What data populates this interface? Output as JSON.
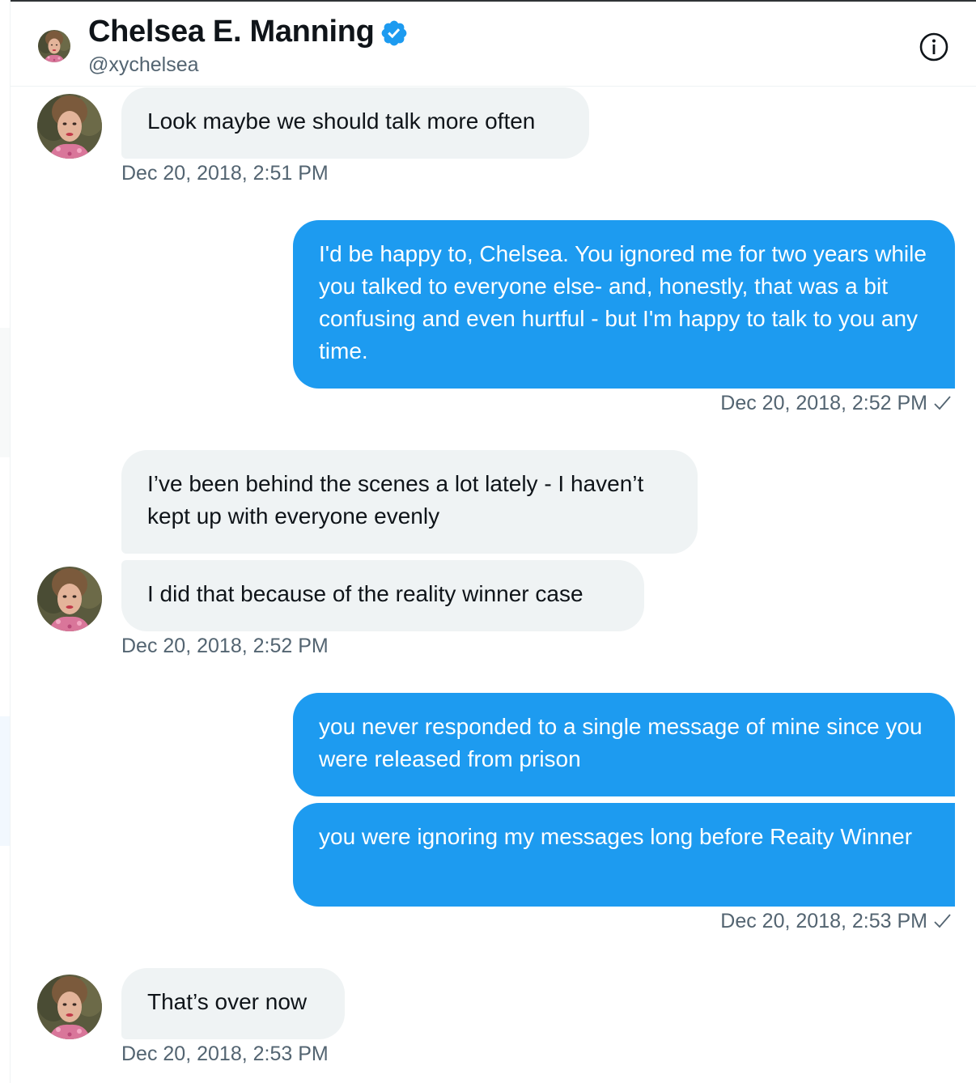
{
  "header": {
    "name": "Chelsea E. Manning",
    "handle": "@xychelsea",
    "verified_icon": "verified-badge-icon",
    "info_icon": "info-icon"
  },
  "colors": {
    "accent": "#1d9bf0",
    "incoming_bubble": "#eff3f4",
    "text_primary": "#0f1419",
    "text_secondary": "#536471"
  },
  "messages": [
    {
      "direction": "incoming",
      "text": "Look maybe we should talk more often",
      "time": "Dec 20, 2018, 2:51 PM"
    },
    {
      "direction": "outgoing",
      "text": "I'd be happy to, Chelsea. You ignored me for two years while you talked to everyone else-  and, honestly, that was a bit confusing and even hurtful - but I'm happy to talk to you any time.",
      "time": "Dec 20, 2018, 2:52 PM",
      "status_icon": "check-icon"
    },
    {
      "direction": "incoming",
      "text": "I’ve been behind the scenes a lot lately - I haven’t kept up with everyone evenly"
    },
    {
      "direction": "incoming",
      "text": "I did that because of the reality winner case",
      "time": "Dec 20, 2018, 2:52 PM"
    },
    {
      "direction": "outgoing",
      "text": "you never responded to a single message of mine since you were released from prison"
    },
    {
      "direction": "outgoing",
      "text": "you were ignoring my messages long before Reaity Winner",
      "time": "Dec 20, 2018, 2:53 PM",
      "status_icon": "check-icon"
    },
    {
      "direction": "incoming",
      "text": "That’s over now",
      "time": "Dec 20, 2018, 2:53 PM"
    }
  ]
}
